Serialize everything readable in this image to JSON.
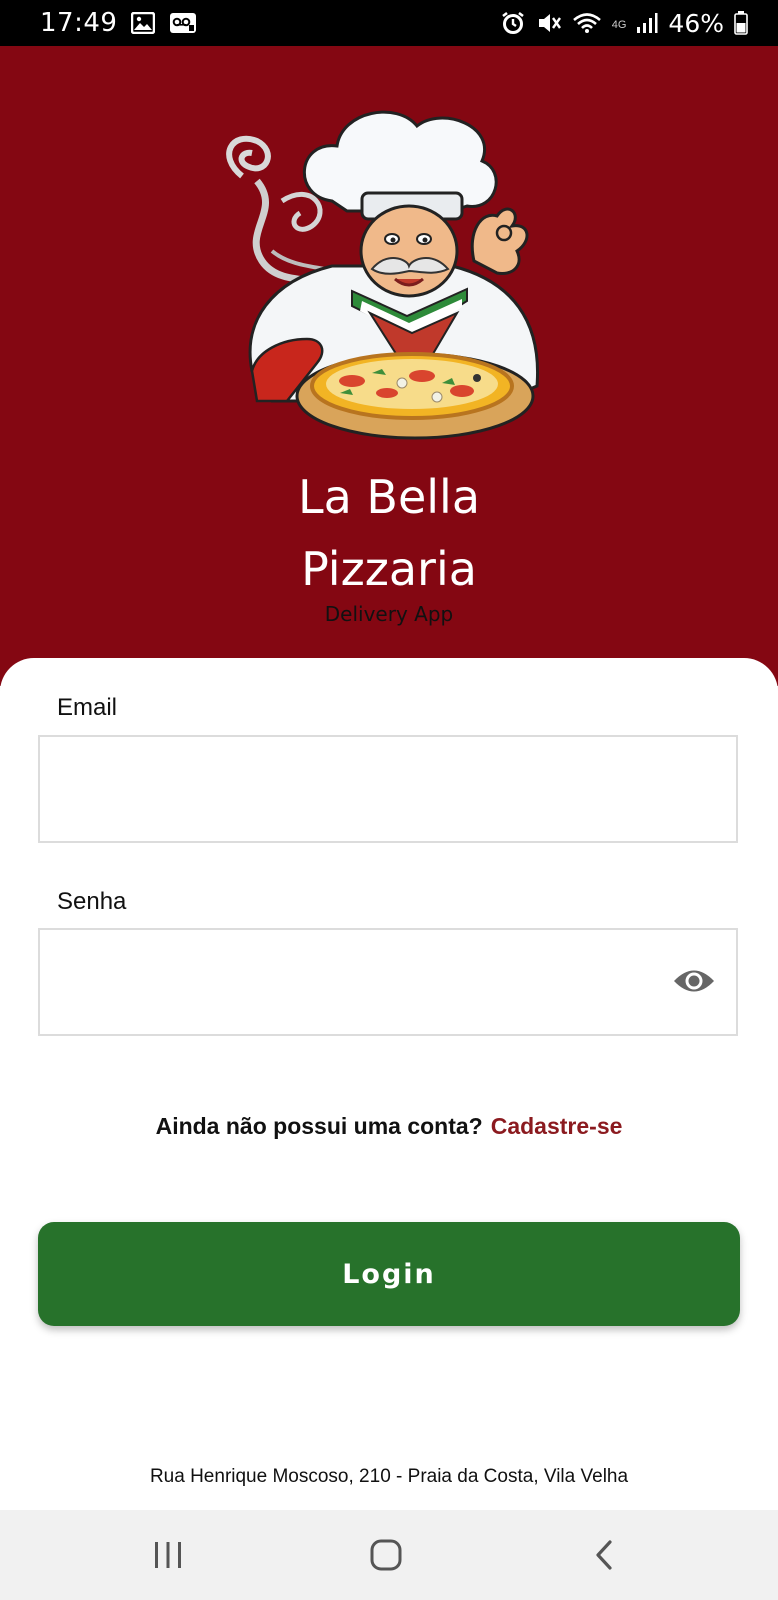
{
  "status_bar": {
    "time": "17:49",
    "network": "4G",
    "battery": "46%",
    "icons": [
      "image-icon",
      "voicemail-icon",
      "alarm-icon",
      "mute-icon",
      "wifi-icon",
      "signal-icon",
      "battery-icon"
    ]
  },
  "header": {
    "title_line1": "La Bella",
    "title_line2": "Pizzaria",
    "subtitle": "Delivery App",
    "logo": "chef-logo",
    "background_color": "#840712"
  },
  "form": {
    "email_label": "Email",
    "email_value": "",
    "password_label": "Senha",
    "password_value": "",
    "password_toggle_icon": "eye-icon"
  },
  "signup": {
    "prompt": "Ainda não possui uma conta?",
    "link": "Cadastre-se",
    "link_color": "#8b1a1f"
  },
  "login_button": {
    "label": "Login",
    "color": "#27722b"
  },
  "footer": {
    "address": "Rua Henrique Moscoso, 210 - Praia da Costa, Vila Velha"
  },
  "nav_bar": {
    "icons": [
      "recent-apps-icon",
      "home-icon",
      "back-icon"
    ]
  }
}
